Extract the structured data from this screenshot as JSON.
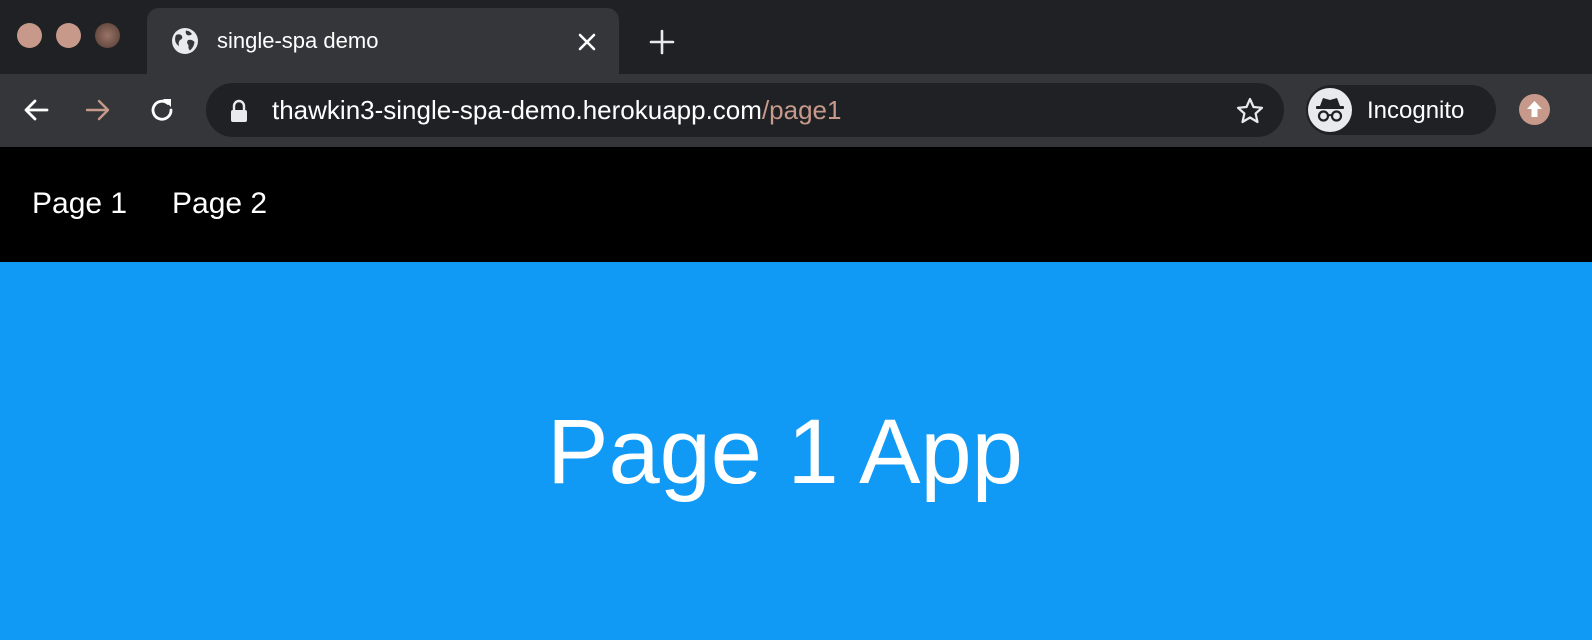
{
  "window": {
    "controls": [
      "close",
      "minimize",
      "zoom"
    ]
  },
  "tab": {
    "title": "single-spa demo",
    "favicon": "globe-icon",
    "close_icon": "close-icon"
  },
  "new_tab_icon": "plus-icon",
  "toolbar": {
    "back_icon": "arrow-left-icon",
    "forward_icon": "arrow-right-icon",
    "reload_icon": "reload-icon",
    "url_host": "thawkin3-single-spa-demo.herokuapp.com",
    "url_path": "/page1",
    "lock_icon": "lock-icon",
    "bookmark_icon": "star-icon",
    "profile_label": "Incognito",
    "profile_icon": "incognito-icon",
    "update_icon": "arrow-up-circle-icon"
  },
  "page": {
    "nav_links": [
      {
        "label": "Page 1"
      },
      {
        "label": "Page 2"
      }
    ],
    "app_title": "Page 1 App"
  },
  "colors": {
    "tabstrip_bg": "#202124",
    "toolbar_bg": "#35363a",
    "accent": "#c6998a",
    "page_nav_bg": "#000000",
    "app_bg": "#119af5",
    "text": "#ffffff"
  }
}
